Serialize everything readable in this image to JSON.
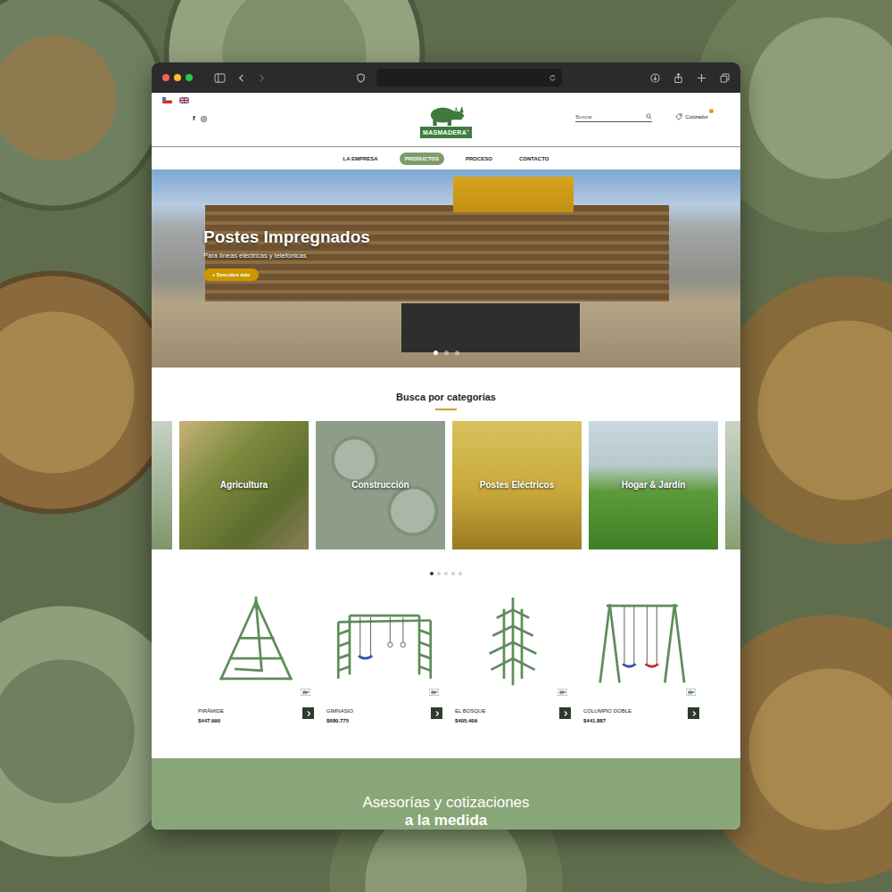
{
  "logo": {
    "text": "MASMADERA",
    "mark": "®"
  },
  "social": {
    "facebook": "f"
  },
  "search": {
    "placeholder": "Buscar"
  },
  "cart": {
    "label": "Cotizador"
  },
  "nav": [
    {
      "label": "LA EMPRESA",
      "selected": false
    },
    {
      "label": "PRODUCTOS",
      "selected": true
    },
    {
      "label": "PROCESO",
      "selected": false
    },
    {
      "label": "CONTACTO",
      "selected": false
    }
  ],
  "hero": {
    "title": "Postes Impregnados",
    "subtitle": "Para líneas eléctricas y telefónicas",
    "button": "+ Descubre más",
    "slides": [
      {
        "selected": true
      },
      {
        "selected": false
      },
      {
        "selected": false
      }
    ]
  },
  "categories": {
    "title": "Busca por categorías",
    "items": [
      {
        "label": "Agricultura"
      },
      {
        "label": "Construcción"
      },
      {
        "label": "Postes Eléctricos"
      },
      {
        "label": "Hogar & Jardín"
      }
    ],
    "pages": [
      {
        "selected": true
      },
      {
        "selected": false
      },
      {
        "selected": false
      },
      {
        "selected": false
      },
      {
        "selected": false
      }
    ]
  },
  "products": [
    {
      "name": "PIRÁMIDE",
      "price": "$447.990",
      "kind": "pyramid"
    },
    {
      "name": "GIMNASIO",
      "price": "$680.775",
      "kind": "gym"
    },
    {
      "name": "EL BOSQUE",
      "price": "$405.409",
      "kind": "tree"
    },
    {
      "name": "COLUMPIO DOBLE",
      "price": "$441.887",
      "kind": "swing"
    }
  ],
  "banner": {
    "line1": "Asesorías y cotizaciones",
    "line2": "a la medida"
  }
}
